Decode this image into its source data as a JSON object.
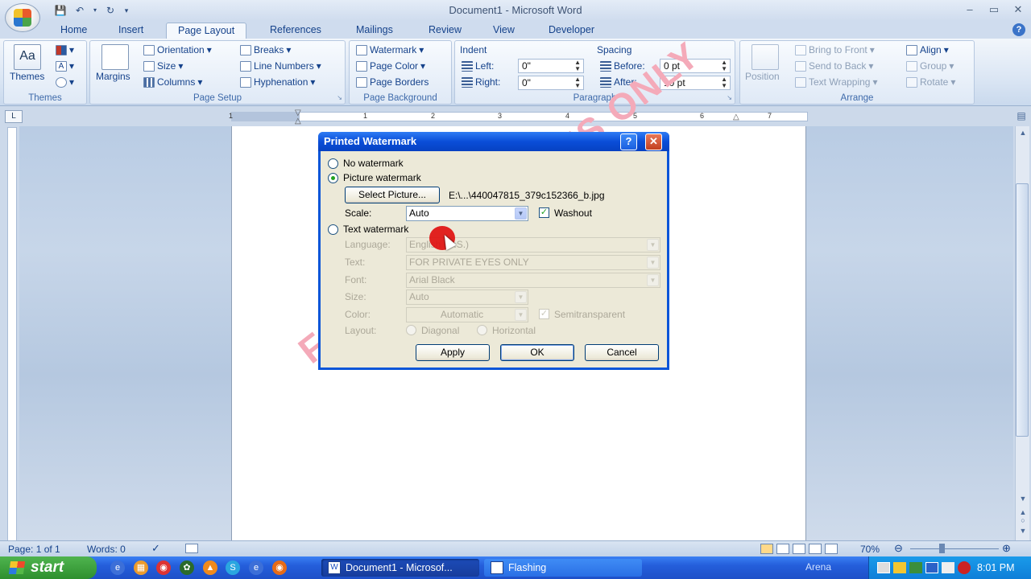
{
  "window": {
    "title": "Document1 - Microsoft Word"
  },
  "tabs": [
    "Home",
    "Insert",
    "Page Layout",
    "References",
    "Mailings",
    "Review",
    "View",
    "Developer"
  ],
  "ribbon": {
    "themes": {
      "label": "Themes",
      "group": "Themes"
    },
    "page_setup": {
      "margins": "Margins",
      "orientation": "Orientation",
      "size": "Size",
      "columns": "Columns",
      "breaks": "Breaks",
      "line_numbers": "Line Numbers",
      "hyphenation": "Hyphenation",
      "group": "Page Setup"
    },
    "page_background": {
      "watermark": "Watermark",
      "page_color": "Page Color",
      "page_borders": "Page Borders",
      "group": "Page Background"
    },
    "paragraph": {
      "indent": "Indent",
      "left_label": "Left:",
      "left_value": "0\"",
      "right_label": "Right:",
      "right_value": "0\"",
      "spacing": "Spacing",
      "before_label": "Before:",
      "before_value": "0 pt",
      "after_label": "After:",
      "after_value": "10 pt",
      "group": "Paragraph"
    },
    "arrange": {
      "position": "Position",
      "bring_to_front": "Bring to Front",
      "send_to_back": "Send to Back",
      "text_wrapping": "Text Wrapping",
      "align": "Align",
      "group_btn": "Group",
      "rotate": "Rotate",
      "group": "Arrange"
    }
  },
  "ruler": {
    "numbers": [
      "1",
      "1",
      "2",
      "3",
      "4",
      "5",
      "6",
      "7"
    ]
  },
  "document": {
    "watermark_text": "FOR PRIVATE EYES ONLY"
  },
  "dialog": {
    "title": "Printed Watermark",
    "no_watermark": "No watermark",
    "picture_watermark": "Picture watermark",
    "select_picture": "Select Picture...",
    "picture_path": "E:\\...\\440047815_379c152366_b.jpg",
    "scale_label": "Scale:",
    "scale_value": "Auto",
    "washout": "Washout",
    "text_watermark": "Text watermark",
    "language_label": "Language:",
    "language_value": "English (U.S.)",
    "text_label": "Text:",
    "text_value": "FOR PRIVATE EYES ONLY",
    "font_label": "Font:",
    "font_value": "Arial Black",
    "size_label": "Size:",
    "size_value": "Auto",
    "color_label": "Color:",
    "color_value": "Automatic",
    "semitransparent": "Semitransparent",
    "layout_label": "Layout:",
    "diagonal": "Diagonal",
    "horizontal": "Horizontal",
    "apply": "Apply",
    "ok": "OK",
    "cancel": "Cancel"
  },
  "status": {
    "page": "Page: 1 of 1",
    "words": "Words: 0",
    "zoom": "70%"
  },
  "taskbar": {
    "start": "start",
    "tasks": [
      "Document1 - Microsof...",
      "Flashing"
    ],
    "arena": "Arena",
    "clock": "8:01 PM"
  }
}
